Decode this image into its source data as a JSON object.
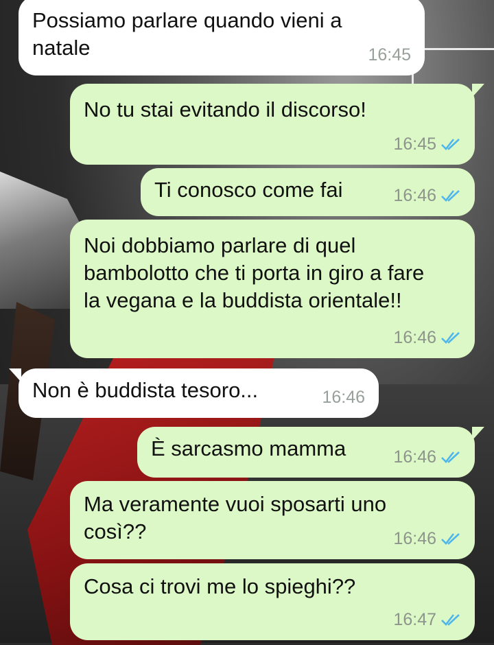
{
  "chat": {
    "messages": [
      {
        "direction": "in",
        "text": "Possiamo parlare quando vieni a natale",
        "time": "16:45",
        "ticks": false
      },
      {
        "direction": "out",
        "text": "No tu stai evitando il discorso!",
        "time": "16:45",
        "ticks": true
      },
      {
        "direction": "out",
        "text": "Ti conosco come fai",
        "time": "16:46",
        "ticks": true
      },
      {
        "direction": "out",
        "text": "Noi dobbiamo parlare di quel bambolotto che ti porta in giro a fare la vegana e la buddista orientale!!",
        "time": "16:46",
        "ticks": true
      },
      {
        "direction": "in",
        "text": "Non è buddista tesoro...",
        "time": "16:46",
        "ticks": false
      },
      {
        "direction": "out",
        "text": "È sarcasmo mamma",
        "time": "16:46",
        "ticks": true
      },
      {
        "direction": "out",
        "text": "Ma veramente vuoi sposarti uno così??",
        "time": "16:46",
        "ticks": true
      },
      {
        "direction": "out",
        "text": "Cosa ci trovi me lo spieghi??",
        "time": "16:47",
        "ticks": true
      }
    ]
  },
  "colors": {
    "incoming_bubble": "#ffffff",
    "outgoing_bubble": "#dcf8c6",
    "read_ticks": "#4fb6ec",
    "timestamp": "#8c948c"
  },
  "icons": {
    "read_receipt": "double-check-icon"
  }
}
